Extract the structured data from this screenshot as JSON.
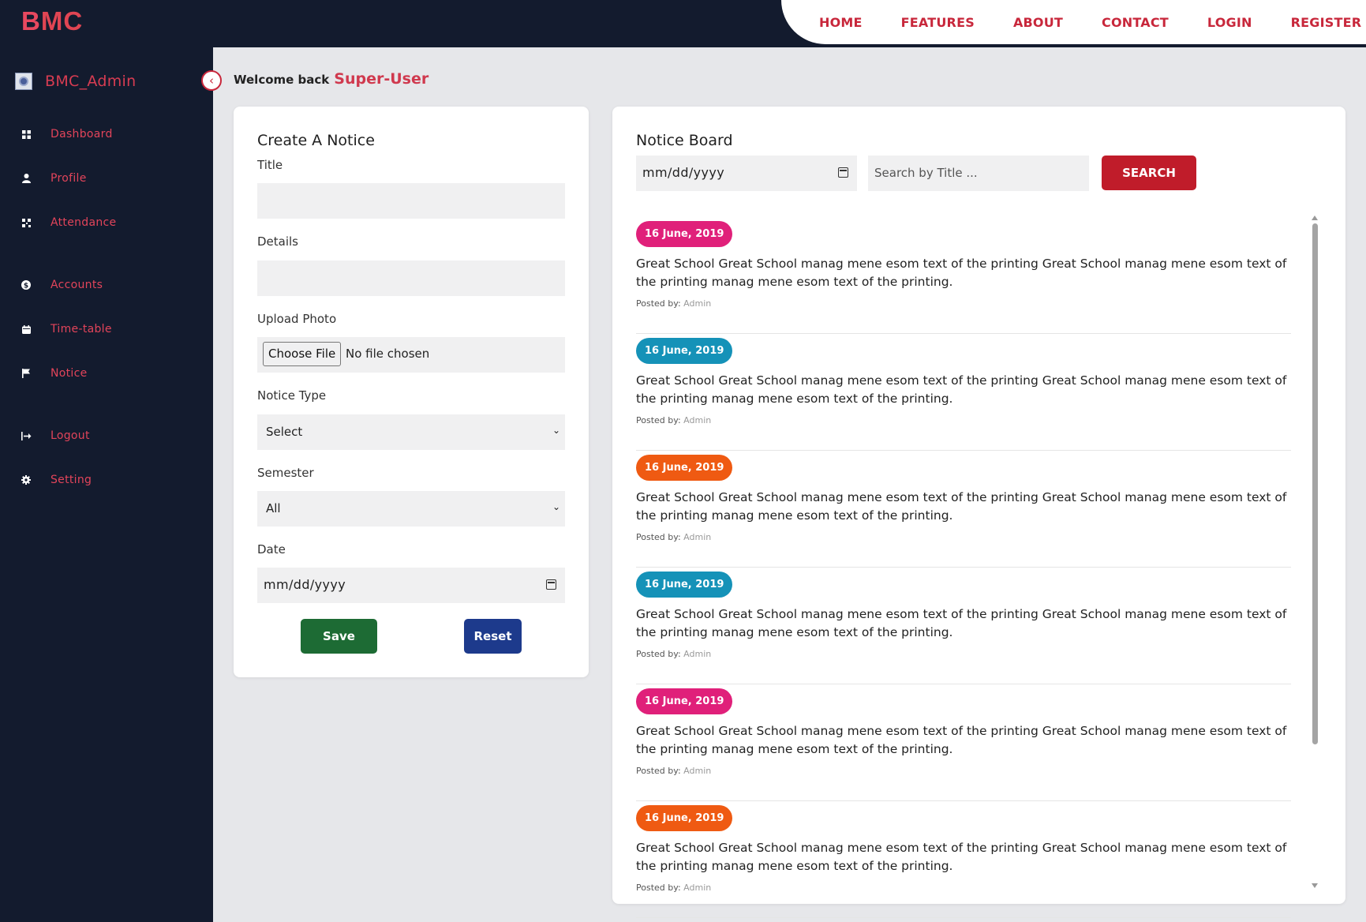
{
  "brand": {
    "first_letter": "B",
    "rest": "MC"
  },
  "topnav": {
    "items": [
      "HOME",
      "FEATURES",
      "ABOUT",
      "CONTACT",
      "LOGIN",
      "REGISTER"
    ]
  },
  "sidebar": {
    "username": "BMC_Admin",
    "toggle_icon": "chevron-left-icon",
    "items": [
      {
        "label": "Dashboard",
        "icon": "grid-icon"
      },
      {
        "label": "Profile",
        "icon": "user-icon"
      },
      {
        "label": "Attendance",
        "icon": "qr-icon"
      },
      {
        "label": "Accounts",
        "icon": "dollar-icon"
      },
      {
        "label": "Time-table",
        "icon": "calendar-icon"
      },
      {
        "label": "Notice",
        "icon": "flag-icon"
      },
      {
        "label": "Logout",
        "icon": "logout-icon"
      },
      {
        "label": "Setting",
        "icon": "gear-icon"
      }
    ]
  },
  "welcome": {
    "text": "Welcome back",
    "user": "Super-User"
  },
  "create_notice": {
    "title": "Create A Notice",
    "title_label": "Title",
    "details_label": "Details",
    "upload_label": "Upload Photo",
    "file_button": "Choose File",
    "file_status": "No file chosen",
    "type_label": "Notice Type",
    "type_value": "Select",
    "semester_label": "Semester",
    "semester_value": "All",
    "date_label": "Date",
    "date_placeholder": "mm/dd/yyyy",
    "save_label": "Save",
    "reset_label": "Reset"
  },
  "notice_board": {
    "title": "Notice Board",
    "date_placeholder": "mm/dd/yyyy",
    "search_placeholder": "Search by Title ...",
    "search_label": "SEARCH",
    "posted_prefix": "Posted by:",
    "notices": [
      {
        "date": "16 June, 2019",
        "color": "#e0207a",
        "text": "Great School Great School manag mene esom text of the printing Great School manag mene esom text of the printing manag mene esom text of the printing.",
        "author": "Admin"
      },
      {
        "date": "16 June, 2019",
        "color": "#1592b8",
        "text": "Great School Great School manag mene esom text of the printing Great School manag mene esom text of the printing manag mene esom text of the printing.",
        "author": "Admin"
      },
      {
        "date": "16 June, 2019",
        "color": "#ef5a12",
        "text": "Great School Great School manag mene esom text of the printing Great School manag mene esom text of the printing manag mene esom text of the printing.",
        "author": "Admin"
      },
      {
        "date": "16 June, 2019",
        "color": "#1592b8",
        "text": "Great School Great School manag mene esom text of the printing Great School manag mene esom text of the printing manag mene esom text of the printing.",
        "author": "Admin"
      },
      {
        "date": "16 June, 2019",
        "color": "#e0207a",
        "text": "Great School Great School manag mene esom text of the printing Great School manag mene esom text of the printing manag mene esom text of the printing.",
        "author": "Admin"
      },
      {
        "date": "16 June, 2019",
        "color": "#ef5a12",
        "text": "Great School Great School manag mene esom text of the printing Great School manag mene esom text of the printing manag mene esom text of the printing.",
        "author": "Admin"
      }
    ]
  },
  "colors": {
    "accent": "#c8273b",
    "save": "#1d6b34",
    "reset": "#1d3a8c",
    "search": "#c01c2a",
    "sidebar_bg": "#131b2e"
  }
}
